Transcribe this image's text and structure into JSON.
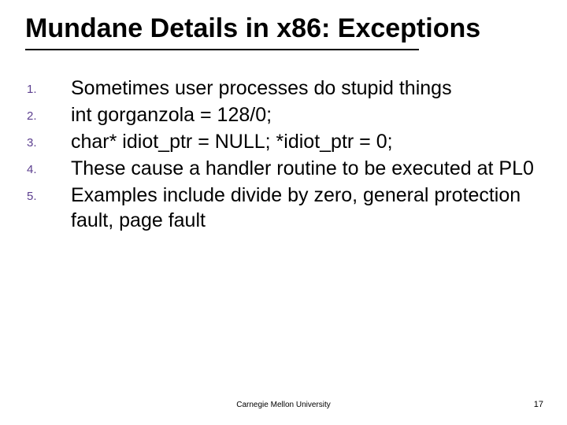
{
  "title": "Mundane Details in x86: Exceptions",
  "items": [
    {
      "n": "1.",
      "t": "Sometimes user processes do stupid things"
    },
    {
      "n": "2.",
      "t": "int gorganzola = 128/0;"
    },
    {
      "n": "3.",
      "t": "char* idiot_ptr = NULL; *idiot_ptr = 0;"
    },
    {
      "n": "4.",
      "t": "These cause a handler routine to be executed at PL0"
    },
    {
      "n": "5.",
      "t": "Examples include divide by zero, general protection fault, page fault"
    }
  ],
  "footer": "Carnegie Mellon University",
  "page": "17"
}
